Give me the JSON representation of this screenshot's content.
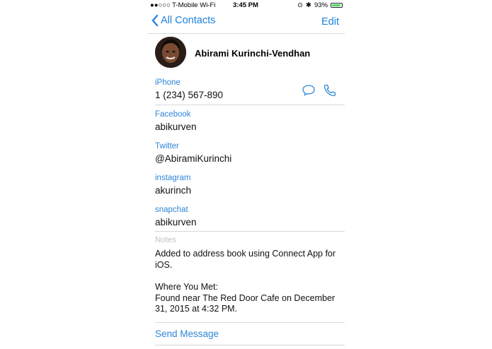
{
  "status_bar": {
    "carrier": "●●○○○ T-Mobile Wi-Fi",
    "time": "3:45 PM",
    "battery": "93%",
    "battery_level": 0.93
  },
  "nav": {
    "back_label": "All Contacts",
    "edit_label": "Edit"
  },
  "contact": {
    "name": "Abirami Kurinchi-Vendhan"
  },
  "fields": [
    {
      "label": "iPhone",
      "value": "1 (234) 567-890"
    },
    {
      "label": "Facebook",
      "value": "abikurven"
    },
    {
      "label": "Twitter",
      "value": "@AbiramiKurinchi"
    },
    {
      "label": "instagram",
      "value": "akurinch"
    },
    {
      "label": "snapchat",
      "value": "abikurven"
    }
  ],
  "notes": {
    "label": "Notes",
    "line1": "Added to address book using Connect App for iOS.",
    "line2": "Where You Met:",
    "line3": "Found near The Red Door Cafe on December 31, 2015 at 4:32 PM."
  },
  "actions": {
    "send_message": "Send Message"
  },
  "colors": {
    "accent": "#2f86d6",
    "battery": "#4cd964"
  }
}
